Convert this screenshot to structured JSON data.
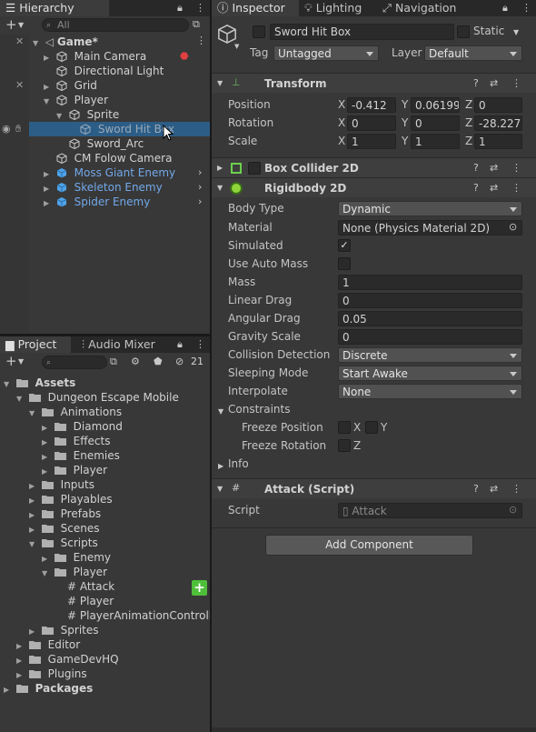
{
  "hierarchy": {
    "tab_label": "Hierarchy",
    "search_placeholder": "All",
    "items": [
      {
        "label": "Game*"
      },
      {
        "label": "Main Camera"
      },
      {
        "label": "Directional Light"
      },
      {
        "label": "Grid"
      },
      {
        "label": "Player"
      },
      {
        "label": "Sprite"
      },
      {
        "label": "Sword Hit Box"
      },
      {
        "label": "Sword_Arc"
      },
      {
        "label": "CM Folow Camera"
      },
      {
        "label": "Moss Giant Enemy"
      },
      {
        "label": "Skeleton Enemy"
      },
      {
        "label": "Spider Enemy"
      }
    ]
  },
  "project": {
    "tab_label": "Project",
    "audio_tab_label": "Audio Mixer",
    "hidden_count": "21",
    "items": [
      {
        "label": "Assets"
      },
      {
        "label": "Dungeon Escape Mobile"
      },
      {
        "label": "Animations"
      },
      {
        "label": "Diamond"
      },
      {
        "label": "Effects"
      },
      {
        "label": "Enemies"
      },
      {
        "label": "Player"
      },
      {
        "label": "Inputs"
      },
      {
        "label": "Playables"
      },
      {
        "label": "Prefabs"
      },
      {
        "label": "Scenes"
      },
      {
        "label": "Scripts"
      },
      {
        "label": "Enemy"
      },
      {
        "label": "Player"
      },
      {
        "label": "Attack"
      },
      {
        "label": "Player"
      },
      {
        "label": "PlayerAnimationControlle"
      },
      {
        "label": "Sprites"
      },
      {
        "label": "Editor"
      },
      {
        "label": "GameDevHQ"
      },
      {
        "label": "Plugins"
      },
      {
        "label": "Packages"
      }
    ]
  },
  "inspector": {
    "tabs": [
      "Inspector",
      "Lighting",
      "Navigation"
    ],
    "object_name": "Sword Hit Box",
    "static_label": "Static",
    "tag_label": "Tag",
    "tag_value": "Untagged",
    "layer_label": "Layer",
    "layer_value": "Default",
    "transform": {
      "title": "Transform",
      "position_label": "Position",
      "rotation_label": "Rotation",
      "scale_label": "Scale",
      "position": {
        "x": "-0.412",
        "y": "0.06199",
        "z": "0"
      },
      "rotation": {
        "x": "0",
        "y": "0",
        "z": "-28.227"
      },
      "scale": {
        "x": "1",
        "y": "1",
        "z": "1"
      },
      "axis_x": "X",
      "axis_y": "Y",
      "axis_z": "Z"
    },
    "box_collider": {
      "title": "Box Collider 2D"
    },
    "rigidbody": {
      "title": "Rigidbody 2D",
      "body_type_label": "Body Type",
      "body_type": "Dynamic",
      "material_label": "Material",
      "material": "None (Physics Material 2D)",
      "simulated_label": "Simulated",
      "auto_mass_label": "Use Auto Mass",
      "mass_label": "Mass",
      "mass": "1",
      "linear_drag_label": "Linear Drag",
      "linear_drag": "0",
      "angular_drag_label": "Angular Drag",
      "angular_drag": "0.05",
      "gravity_label": "Gravity Scale",
      "gravity": "0",
      "collision_label": "Collision Detection",
      "collision": "Discrete",
      "sleeping_label": "Sleeping Mode",
      "sleeping": "Start Awake",
      "interpolate_label": "Interpolate",
      "interpolate": "None",
      "constraints_label": "Constraints",
      "freeze_pos_label": "Freeze Position",
      "freeze_rot_label": "Freeze Rotation",
      "info_label": "Info"
    },
    "attack": {
      "title": "Attack (Script)",
      "script_label": "Script",
      "script_value": "Attack"
    },
    "add_component": "Add Component"
  }
}
